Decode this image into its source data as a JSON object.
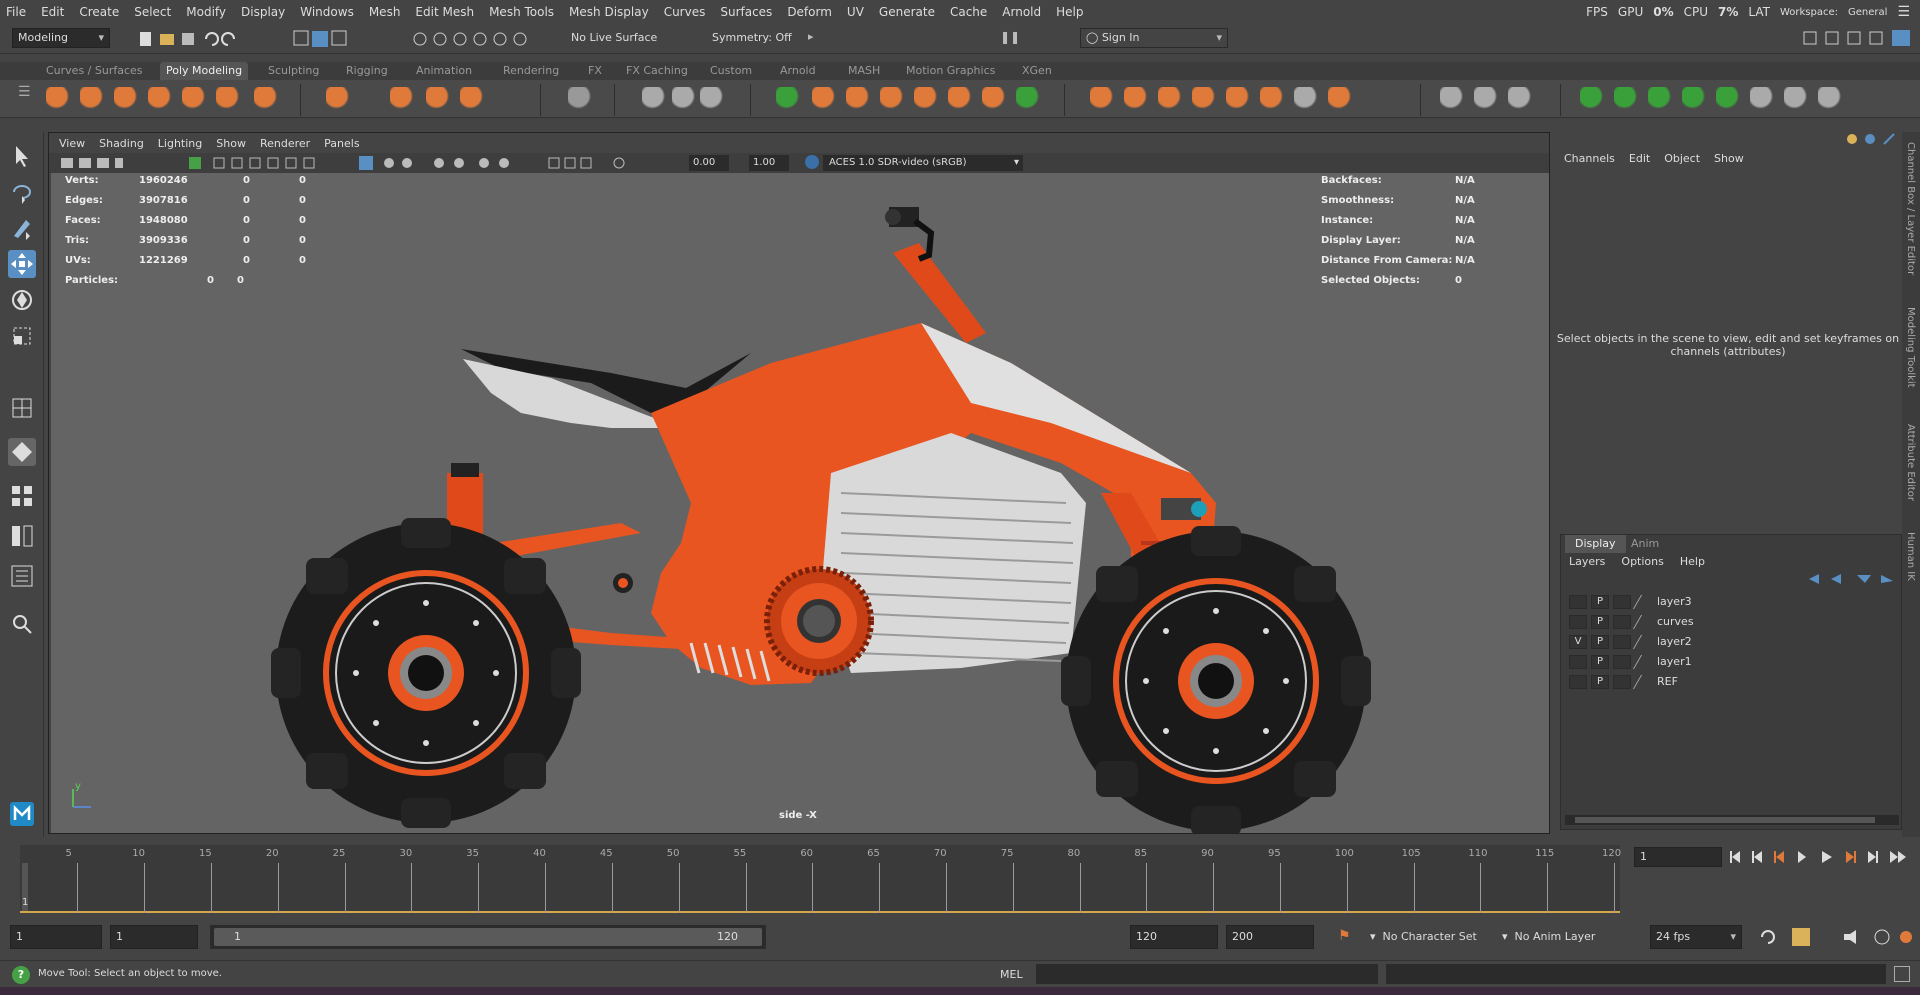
{
  "menubar": [
    "File",
    "Edit",
    "Create",
    "Select",
    "Modify",
    "Display",
    "Windows",
    "Mesh",
    "Edit Mesh",
    "Mesh Tools",
    "Mesh Display",
    "Curves",
    "Surfaces",
    "Deform",
    "UV",
    "Generate",
    "Cache",
    "Arnold",
    "Help"
  ],
  "topright": {
    "fps": "FPS",
    "gpu": "GPU",
    "gpu_val": "0%",
    "cpu": "CPU",
    "cpu_val": "7%",
    "lat": "LAT",
    "workspace": "Workspace:",
    "workspace_name": "General"
  },
  "status": {
    "mode": "Modeling",
    "live_surface": "No Live Surface",
    "symmetry": "Symmetry: Off",
    "signin": "Sign In"
  },
  "shelf_tabs": [
    "Curves / Surfaces",
    "Poly Modeling",
    "Sculpting",
    "Rigging",
    "Animation",
    "Rendering",
    "FX",
    "FX Caching",
    "Custom",
    "Arnold",
    "MASH",
    "Motion Graphics",
    "XGen"
  ],
  "active_shelf": "Poly Modeling",
  "viewport": {
    "menu": [
      "View",
      "Shading",
      "Lighting",
      "Show",
      "Renderer",
      "Panels"
    ],
    "exposure": "0.00",
    "gamma": "1.00",
    "colorspace": "ACES 1.0 SDR-video (sRGB)",
    "camera_label": "side -X",
    "axis_y": "y",
    "hud_left": [
      {
        "label": "Verts:",
        "v1": "1960246",
        "v2": "0",
        "v3": "0"
      },
      {
        "label": "Edges:",
        "v1": "3907816",
        "v2": "0",
        "v3": "0"
      },
      {
        "label": "Faces:",
        "v1": "1948080",
        "v2": "0",
        "v3": "0"
      },
      {
        "label": "Tris:",
        "v1": "3909336",
        "v2": "0",
        "v3": "0"
      },
      {
        "label": "UVs:",
        "v1": "1221269",
        "v2": "0",
        "v3": "0"
      },
      {
        "label": "Particles:",
        "v1": "0",
        "v2": "0",
        "v3": ""
      }
    ],
    "hud_right": [
      {
        "label": "Backfaces:",
        "value": "N/A"
      },
      {
        "label": "Smoothness:",
        "value": "N/A"
      },
      {
        "label": "Instance:",
        "value": "N/A"
      },
      {
        "label": "Display Layer:",
        "value": "N/A"
      },
      {
        "label": "Distance From Camera:",
        "value": "N/A"
      },
      {
        "label": "Selected Objects:",
        "value": "0"
      }
    ]
  },
  "channelbox": {
    "menu": [
      "Channels",
      "Edit",
      "Object",
      "Show"
    ],
    "message": "Select objects in the scene to view, edit and set keyframes on channels (attributes)"
  },
  "layers": {
    "tabs": [
      "Display",
      "Anim"
    ],
    "menu": [
      "Layers",
      "Options",
      "Help"
    ],
    "rows": [
      {
        "v": "",
        "p": "P",
        "name": "layer3"
      },
      {
        "v": "",
        "p": "P",
        "name": "curves"
      },
      {
        "v": "V",
        "p": "P",
        "name": "layer2"
      },
      {
        "v": "",
        "p": "P",
        "name": "layer1"
      },
      {
        "v": "",
        "p": "P",
        "name": "REF"
      }
    ]
  },
  "side_tabs": [
    "Channel Box / Layer Editor",
    "Modeling Toolkit",
    "Attribute Editor",
    "Human IK"
  ],
  "timeline": {
    "ticks": [
      "5",
      "10",
      "15",
      "20",
      "25",
      "30",
      "35",
      "40",
      "45",
      "50",
      "55",
      "60",
      "65",
      "70",
      "75",
      "80",
      "85",
      "90",
      "95",
      "100",
      "105",
      "110",
      "115",
      "120"
    ],
    "current_marker": "1",
    "current_frame": "1"
  },
  "range": {
    "start": "1",
    "playstart": "1",
    "slider_start": "1",
    "slider_end": "120",
    "end": "120",
    "anim_end": "200",
    "char_set": "No Character Set",
    "anim_layer": "No Anim Layer",
    "fps": "24 fps"
  },
  "cmd": {
    "help": "Move Tool: Select an object to move.",
    "lang": "MEL"
  }
}
